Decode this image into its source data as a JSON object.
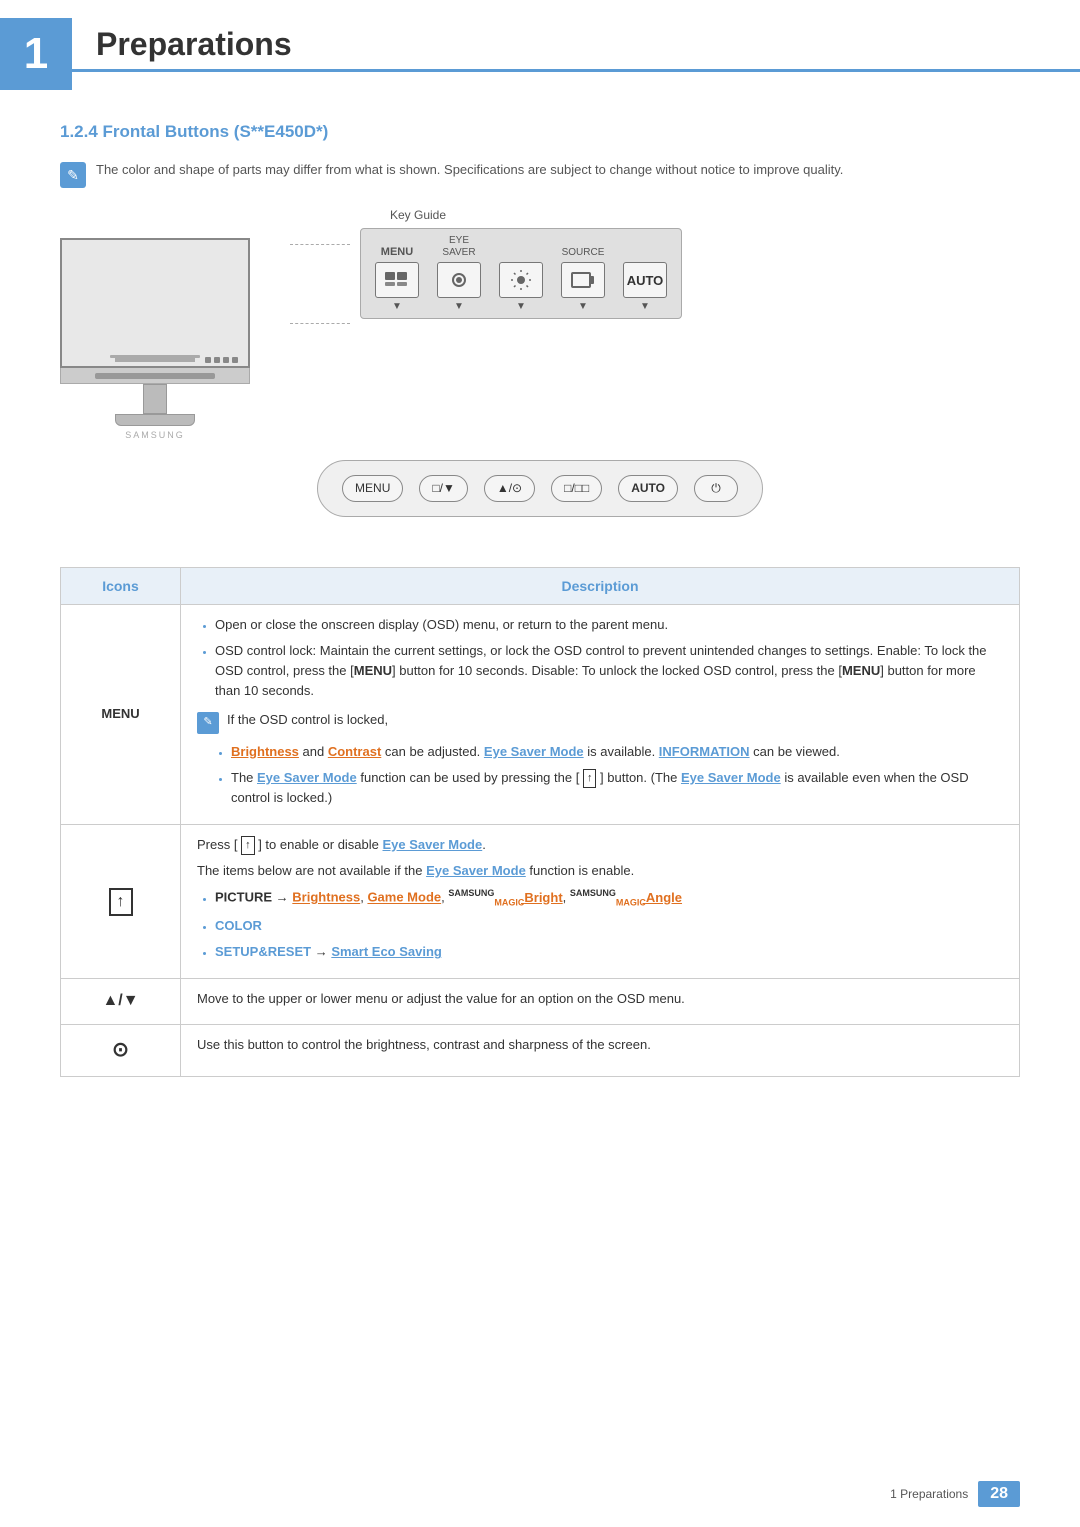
{
  "chapter": {
    "number": "1",
    "title": "Preparations"
  },
  "section": {
    "heading": "1.2.4   Frontal Buttons (S**E450D*)"
  },
  "note": {
    "text": "The color and shape of parts may differ from what is shown. Specifications are subject to change without notice to improve quality."
  },
  "key_guide": {
    "label": "Key Guide",
    "buttons": [
      {
        "top_label": "",
        "label": "MENU",
        "symbol": "⊟⊟"
      },
      {
        "top_label": "EYE\nSAVER",
        "label": "",
        "symbol": "◎"
      },
      {
        "top_label": "",
        "label": "",
        "symbol": "⋮⋮⋮"
      },
      {
        "top_label": "",
        "label": "SOURCE",
        "symbol": "⊟"
      },
      {
        "top_label": "",
        "label": "AUTO",
        "symbol": "AUTO"
      }
    ]
  },
  "front_buttons": [
    {
      "label": "MENU"
    },
    {
      "label": "□/▼"
    },
    {
      "label": "▲/⊙"
    },
    {
      "label": "□/□□"
    },
    {
      "label": "AUTO"
    },
    {
      "label": "⏻"
    }
  ],
  "table": {
    "col1": "Icons",
    "col2": "Description",
    "rows": [
      {
        "icon": "MENU",
        "descriptions": [
          {
            "type": "bullet",
            "text": "Open or close the onscreen display (OSD) menu, or return to the parent menu."
          },
          {
            "type": "bullet",
            "text": "OSD control lock: Maintain the current settings, or lock the OSD control to prevent unintended changes to settings. Enable: To lock the OSD control, press the [MENU] button for 10 seconds. Disable: To unlock the locked OSD control, press the [MENU] button for more than 10 seconds.",
            "has_menu_bold": true
          },
          {
            "type": "note",
            "text": "If the OSD control is locked,"
          },
          {
            "type": "sub_bullet",
            "text": "Brightness and Contrast can be adjusted. Eye Saver Mode is available. INFORMATION can be viewed."
          },
          {
            "type": "sub_bullet",
            "text": "The Eye Saver Mode function can be used by pressing the [▲] button. (The Eye Saver Mode is available even when the OSD control is locked.)"
          }
        ]
      },
      {
        "icon": "↑_box",
        "descriptions": [
          {
            "type": "plain",
            "text": "Press [▲] to enable or disable Eye Saver Mode."
          },
          {
            "type": "plain",
            "text": "The items below are not available if the Eye Saver Mode function is enable."
          },
          {
            "type": "bullet",
            "text": "PICTURE → Brightness, Game Mode, SAMSUNGMAGICBright, SAMSUNGMAGICAngle"
          },
          {
            "type": "bullet",
            "text": "COLOR",
            "is_color": true
          },
          {
            "type": "bullet",
            "text": "SETUP&RESET → Smart Eco Saving"
          }
        ]
      },
      {
        "icon": "▲/▼",
        "descriptions": [
          {
            "type": "plain",
            "text": "Move to the upper or lower menu or adjust the value for an option on the OSD menu."
          }
        ]
      },
      {
        "icon": "◎",
        "descriptions": [
          {
            "type": "plain",
            "text": "Use this button to control the brightness, contrast and sharpness of the screen."
          }
        ]
      }
    ]
  },
  "footer": {
    "text": "1 Preparations",
    "page": "28"
  }
}
